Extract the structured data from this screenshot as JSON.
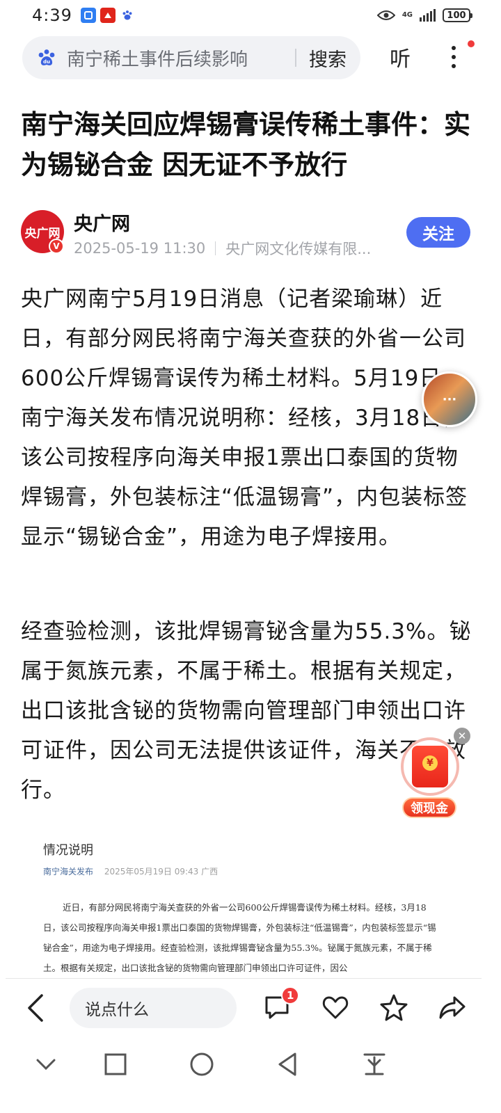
{
  "status_bar": {
    "time": "4:39",
    "network": "4G",
    "battery": "100"
  },
  "search": {
    "query": "南宁稀土事件后续影响",
    "search_label": "搜索",
    "listen_label": "听"
  },
  "article": {
    "title": "南宁海关回应焊锡膏误传稀土事件：实为锡铋合金 因无证不予放行",
    "author": "央广网",
    "avatar_text": "央广网",
    "verified_mark": "V",
    "date": "2025-05-19 11:30",
    "publisher": "央广网文化传媒有限...",
    "follow_label": "关注",
    "paragraphs": [
      "央广网南宁5月19日消息（记者梁瑜琳）近日，有部分网民将南宁海关查获的外省一公司600公斤焊锡膏误传为稀土材料。5月19日，南宁海关发布情况说明称：经核，3月18日，该公司按程序向海关申报1票出口泰国的货物焊锡膏，外包装标注“低温锡膏”，内包装标签显示“锡铋合金”，用途为电子焊接用。",
      "经查验检测，该批焊锡膏铋含量为55.3%。铋属于氮族元素，不属于稀土。根据有关规定，出口该批含铋的货物需向管理部门申领出口许可证件，因公司无法提供该证件，海关不予放行。"
    ]
  },
  "notice_image": {
    "title": "情况说明",
    "source": "南宁海关发布",
    "date": "2025年05月19日 09:43  广西",
    "body": "近日，有部分网民将南宁海关查获的外省一公司600公斤焊锡膏误传为稀土材料。经核，3月18日，该公司按程序向海关申报1票出口泰国的货物焊锡膏，外包装标注“低温锡膏”，内包装标签显示“锡铋合金”，用途为电子焊接用。经查验检测，该批焊锡膏铋含量为55.3%。铋属于氮族元素，不属于稀土。根据有关规定，出口该批含铋的货物需向管理部门申领出口许可证件，因公"
  },
  "floating": {
    "avatar_text": "···",
    "close_symbol": "✕",
    "cash_label": "领现金"
  },
  "bottom_bar": {
    "comment_placeholder": "说点什么",
    "comment_count": "1"
  },
  "icons": {
    "status_apps": [
      "app-icon-blue",
      "app-icon-red",
      "baidu-paw-icon"
    ],
    "actions": [
      "back-icon",
      "comment-icon",
      "like-icon",
      "star-icon",
      "share-icon"
    ],
    "system_nav": [
      "collapse-icon",
      "recents-icon",
      "home-icon",
      "back-nav-icon",
      "download-icon"
    ]
  },
  "colors": {
    "accent": "#4e6ef2",
    "brand_red": "#d81e28",
    "badge_red": "#f03b3b"
  }
}
